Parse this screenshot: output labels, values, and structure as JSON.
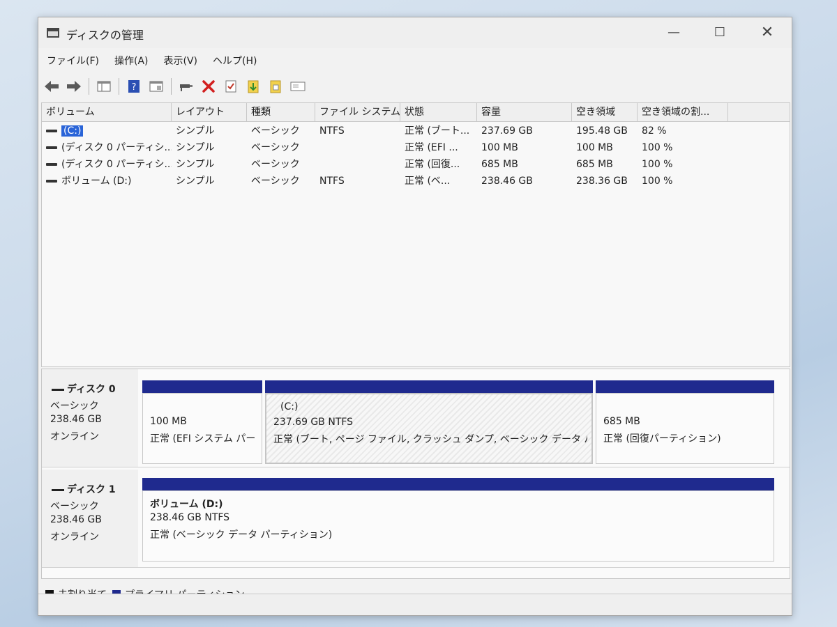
{
  "window": {
    "title": "ディスクの管理",
    "controls": {
      "minimize": "—",
      "maximize": "☐",
      "close": "✕"
    }
  },
  "menubar": [
    "ファイル(F)",
    "操作(A)",
    "表示(V)",
    "ヘルプ(H)"
  ],
  "toolbar": {
    "icons": [
      "back-arrow-icon",
      "forward-arrow-icon",
      "console-tree-icon",
      "help-icon",
      "properties-icon",
      "connect-icon",
      "delete-icon",
      "checklist-icon",
      "export-icon",
      "import-icon",
      "view-icon"
    ]
  },
  "volume_table": {
    "columns": [
      "ボリューム",
      "レイアウト",
      "種類",
      "ファイル システム",
      "状態",
      "容量",
      "空き領域",
      "空き領域の割..."
    ],
    "rows": [
      [
        "(C:)",
        "シンプル",
        "ベーシック",
        "NTFS",
        "正常 (ブート...",
        "237.69 GB",
        "195.48 GB",
        "82 %"
      ],
      [
        "(ディスク 0 パーティシ...",
        "シンプル",
        "ベーシック",
        "",
        "正常 (EFI ...",
        "100 MB",
        "100 MB",
        "100 %"
      ],
      [
        "(ディスク 0 パーティシ...",
        "シンプル",
        "ベーシック",
        "",
        "正常 (回復...",
        "685 MB",
        "685 MB",
        "100 %"
      ],
      [
        "ボリューム (D:)",
        "シンプル",
        "ベーシック",
        "NTFS",
        "正常 (ベ...",
        "238.46 GB",
        "238.36 GB",
        "100 %"
      ]
    ]
  },
  "disks": [
    {
      "name": "ディスク 0",
      "type": "ベーシック",
      "size": "238.46 GB",
      "status": "オンライン",
      "partitions": [
        {
          "title": "",
          "size": "100 MB",
          "status": "正常 (EFI システム パー"
        },
        {
          "title": "(C:)",
          "size": "237.69 GB NTFS",
          "status": "正常 (ブート, ページ ファイル, クラッシュ ダンプ, ベーシック データ パーテ"
        },
        {
          "title": "",
          "size": "685 MB",
          "status": "正常 (回復パーティション)"
        }
      ]
    },
    {
      "name": "ディスク 1",
      "type": "ベーシック",
      "size": "238.46 GB",
      "status": "オンライン",
      "partitions": [
        {
          "title": "ボリューム (D:)",
          "size": "238.46 GB NTFS",
          "status": "正常 (ベーシック データ パーティション)"
        }
      ]
    }
  ],
  "legend": [
    {
      "label": "未割り当て",
      "color": "#111111"
    },
    {
      "label": "プライマリ パーティション",
      "color": "#1f2a8e"
    }
  ],
  "colors": {
    "partition_bar": "#1f2a8e",
    "selection": "#2a64d8"
  }
}
